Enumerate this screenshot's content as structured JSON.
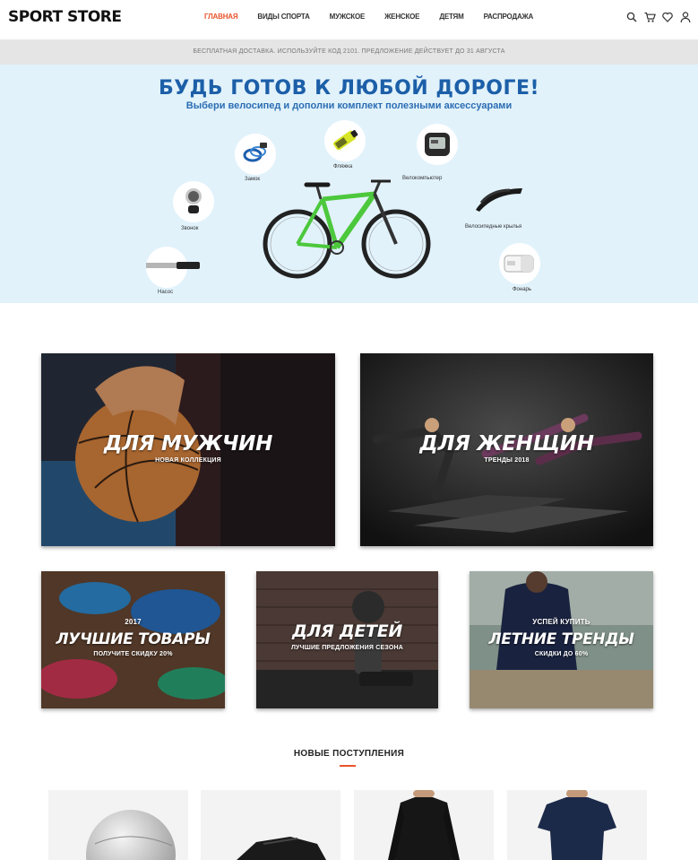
{
  "header": {
    "logo": "SPORT STORE",
    "nav": [
      {
        "label": "Главная",
        "active": true
      },
      {
        "label": "Виды спорта",
        "active": false
      },
      {
        "label": "Мужское",
        "active": false
      },
      {
        "label": "Женское",
        "active": false
      },
      {
        "label": "Детям",
        "active": false
      },
      {
        "label": "Распродажа",
        "active": false
      }
    ],
    "icons": [
      "search-icon",
      "cart-icon",
      "heart-icon",
      "user-icon"
    ]
  },
  "notice": "Бесплатная доставка. Используйте код 2101. Предложение действует до 31 августа",
  "hero": {
    "title": "БУДЬ ГОТОВ К ЛЮБОЙ ДОРОГЕ!",
    "subtitle": "Выбери велосипед и дополни комплект полезными аксессуарами",
    "accessories": [
      "Замок",
      "Фляжка",
      "Велокомпьютер",
      "Звонок",
      "Велосипедные крылья",
      "Насос",
      "Фонарь"
    ]
  },
  "tiles": {
    "men": {
      "title": "ДЛЯ МУЖЧИН",
      "subtitle": "НОВАЯ КОЛЛЕКЦИЯ"
    },
    "women": {
      "title": "ДЛЯ ЖЕНЩИН",
      "subtitle": "ТРЕНДЫ 2018"
    },
    "best": {
      "year": "2017",
      "title": "ЛУЧШИЕ ТОВАРЫ",
      "subtitle": "ПОЛУЧИТЕ СКИДКУ 20%"
    },
    "kids": {
      "title": "ДЛЯ ДЕТЕЙ",
      "subtitle": "ЛУЧШИЕ ПРЕДЛОЖЕНИЯ СЕЗОНА"
    },
    "summer": {
      "pre": "УСПЕЙ КУПИТЬ",
      "title": "ЛЕТНИЕ ТРЕНДЫ",
      "subtitle": "СКИДКИ ДО 60%"
    }
  },
  "new_arrivals": {
    "title": "НОВЫЕ ПОСТУПЛЕНИЯ",
    "products": [
      "fitball",
      "sneaker",
      "longsleeve",
      "tshirt"
    ]
  },
  "colors": {
    "accent": "#e8542c",
    "hero_bg": "#e1f2fb",
    "hero_title": "#1c5fa8"
  }
}
